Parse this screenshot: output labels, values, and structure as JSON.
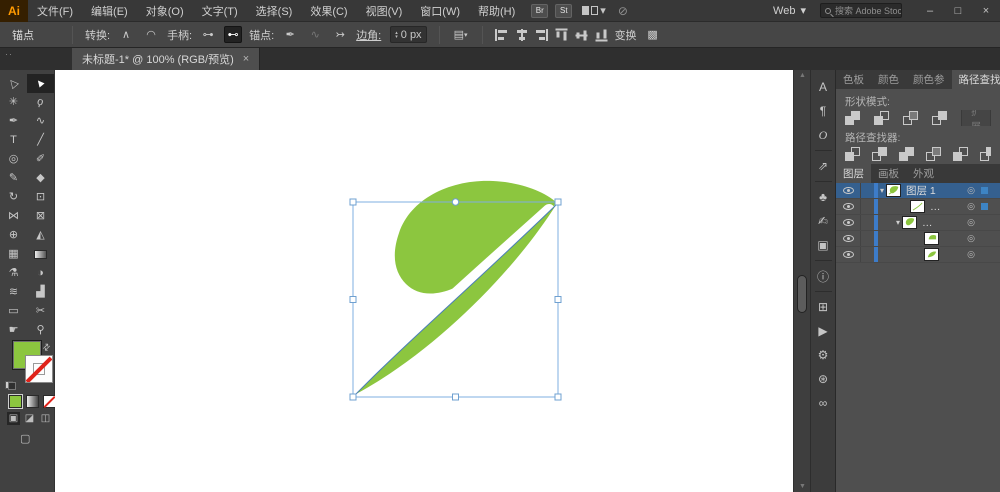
{
  "titlebar": {
    "logo": "Ai",
    "menus": [
      "文件(F)",
      "编辑(E)",
      "对象(O)",
      "文字(T)",
      "选择(S)",
      "效果(C)",
      "视图(V)",
      "窗口(W)",
      "帮助(H)"
    ],
    "badges": [
      "Br",
      "St"
    ],
    "workspace": "Web",
    "search_placeholder": "搜索 Adobe Stock",
    "win_min": "–",
    "win_max": "□",
    "win_close": "×"
  },
  "controlbar": {
    "context": "锚点",
    "convert": "转换:",
    "handles": "手柄:",
    "anchor": "锚点:",
    "corner": "边角:",
    "corner_value": "0 px",
    "transform": "变换"
  },
  "tabbar": {
    "collapse": "··",
    "doc_title": "未标题-1* @ 100% (RGB/预览)",
    "close": "×"
  },
  "tools": [
    {
      "n": "direct-selection-tool",
      "g": "△"
    },
    {
      "n": "selection-tool",
      "g": "▲"
    },
    {
      "n": "magic-wand-tool",
      "g": "✳"
    },
    {
      "n": "lasso-tool",
      "g": "ϙ"
    },
    {
      "n": "pen-tool",
      "g": "✒"
    },
    {
      "n": "curvature-tool",
      "g": "∿"
    },
    {
      "n": "type-tool",
      "g": "T"
    },
    {
      "n": "line-segment-tool",
      "g": "╱"
    },
    {
      "n": "shaper-tool",
      "g": "◎"
    },
    {
      "n": "paintbrush-tool",
      "g": "✐"
    },
    {
      "n": "pencil-tool",
      "g": "✎"
    },
    {
      "n": "eraser-tool",
      "g": "◆"
    },
    {
      "n": "rotate-tool",
      "g": "↻"
    },
    {
      "n": "scale-tool",
      "g": "⊡"
    },
    {
      "n": "width-tool",
      "g": "⋈"
    },
    {
      "n": "free-transform-tool",
      "g": "⊠"
    },
    {
      "n": "shape-builder-tool",
      "g": "⊕"
    },
    {
      "n": "perspective-grid-tool",
      "g": "◭"
    },
    {
      "n": "mesh-tool",
      "g": "▦"
    },
    {
      "n": "gradient-tool",
      "g": ""
    },
    {
      "n": "eyedropper-tool",
      "g": "⚗"
    },
    {
      "n": "blend-tool",
      "g": "◑"
    },
    {
      "n": "symbol-sprayer-tool",
      "g": "≋"
    },
    {
      "n": "column-graph-tool",
      "g": "▟"
    },
    {
      "n": "artboard-tool",
      "g": "▭"
    },
    {
      "n": "slice-tool",
      "g": "✂"
    },
    {
      "n": "hand-tool",
      "g": "☛"
    },
    {
      "n": "zoom-tool",
      "g": "⚲"
    }
  ],
  "strip": [
    {
      "n": "character-panel",
      "g": "A"
    },
    {
      "n": "paragraph-panel",
      "g": "¶"
    },
    {
      "n": "opentype-panel",
      "g": "O"
    },
    {
      "n": "export-panel",
      "g": "⇗"
    },
    {
      "n": "symbols-panel",
      "g": "♣"
    },
    {
      "n": "brushes-panel",
      "g": "✍"
    },
    {
      "n": "graphic-styles-panel",
      "g": "▣"
    },
    {
      "n": "info-panel",
      "g": "ⓘ"
    },
    {
      "n": "transform-panel",
      "g": "⊞"
    },
    {
      "n": "actions-panel",
      "g": "▶"
    },
    {
      "n": "settings-panel",
      "g": "⚙"
    },
    {
      "n": "creative-cloud-panel",
      "g": "⊛"
    },
    {
      "n": "links-panel",
      "g": "∞"
    }
  ],
  "pathfinder": {
    "tabs": [
      "色板",
      "颜色",
      "颜色参",
      "路径查找器"
    ],
    "active_tab": "路径查找器",
    "shape_modes_label": "形状模式:",
    "pathfinder_label": "路径查找器:",
    "expand_button": "扩展"
  },
  "layers": {
    "tabs": [
      "图层",
      "画板",
      "外观"
    ],
    "active_tab": "图层",
    "rows": [
      {
        "name": "图层 1"
      },
      {
        "name": "…"
      },
      {
        "name": "…"
      },
      {
        "name": ""
      },
      {
        "name": ""
      }
    ]
  },
  "canvas": {
    "artwork": "leaf-logo",
    "zoom_level": "100%",
    "artwork_green": "#8CC63F",
    "selection_blue": "#7FAFE0",
    "path_blue": "#4A7EB8"
  },
  "glyphs": {
    "caret": "▾",
    "convert1": "∧",
    "convert2": "◠",
    "handle1": "⊶",
    "handle2": "⊷",
    "anchor1": "✒",
    "anchor2": "∿",
    "anchor3": "↣",
    "step_up": "▴",
    "step_down": "▾",
    "doc_setup": "▤",
    "transform_icon": "▩",
    "muted_icon": "⊘",
    "swap": "⇄",
    "mode1": "▣",
    "mode2": "◪",
    "mode3": "◫",
    "screen": "▢",
    "target": "◎",
    "larrow": "▼"
  }
}
